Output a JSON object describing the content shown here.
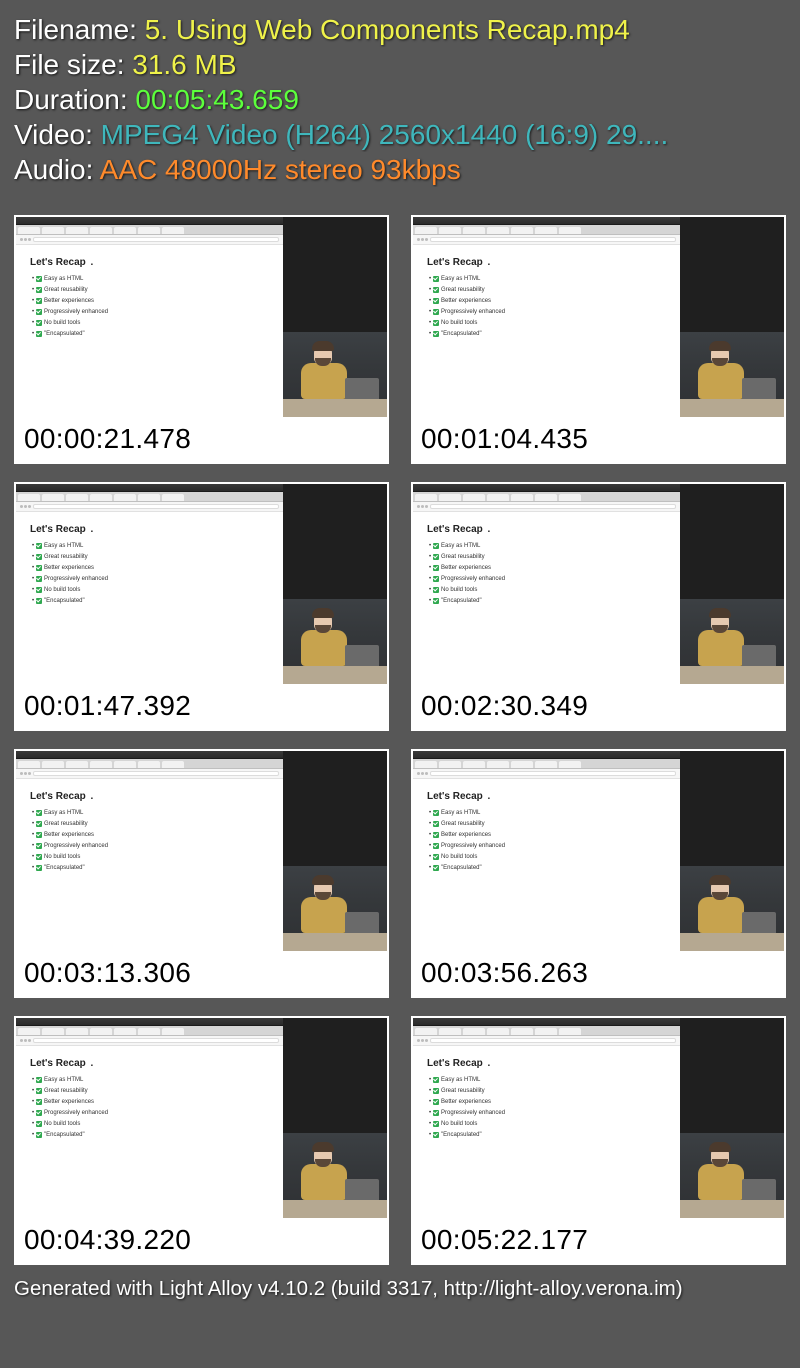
{
  "info": {
    "filename_label": "Filename: ",
    "filename_value": "5. Using Web Components Recap.mp4",
    "filesize_label": "File size: ",
    "filesize_value": "31.6 MB",
    "duration_label": "Duration: ",
    "duration_value": "00:05:43.659",
    "video_label": "Video: ",
    "video_value": "MPEG4 Video (H264) 2560x1440 (16:9) 29....",
    "audio_label": "Audio: ",
    "audio_value": "AAC 48000Hz stereo 93kbps"
  },
  "slide": {
    "title": "Let's Recap",
    "items": [
      "Easy as HTML",
      "Great reusability",
      "Better experiences",
      "Progressively enhanced",
      "No build tools",
      "\"Encapsulated\""
    ]
  },
  "thumbnails": [
    {
      "time": "00:00:21.478"
    },
    {
      "time": "00:01:04.435"
    },
    {
      "time": "00:01:47.392"
    },
    {
      "time": "00:02:30.349"
    },
    {
      "time": "00:03:13.306"
    },
    {
      "time": "00:03:56.263"
    },
    {
      "time": "00:04:39.220"
    },
    {
      "time": "00:05:22.177"
    }
  ],
  "footer": "Generated with Light Alloy v4.10.2 (build 3317, http://light-alloy.verona.im)"
}
